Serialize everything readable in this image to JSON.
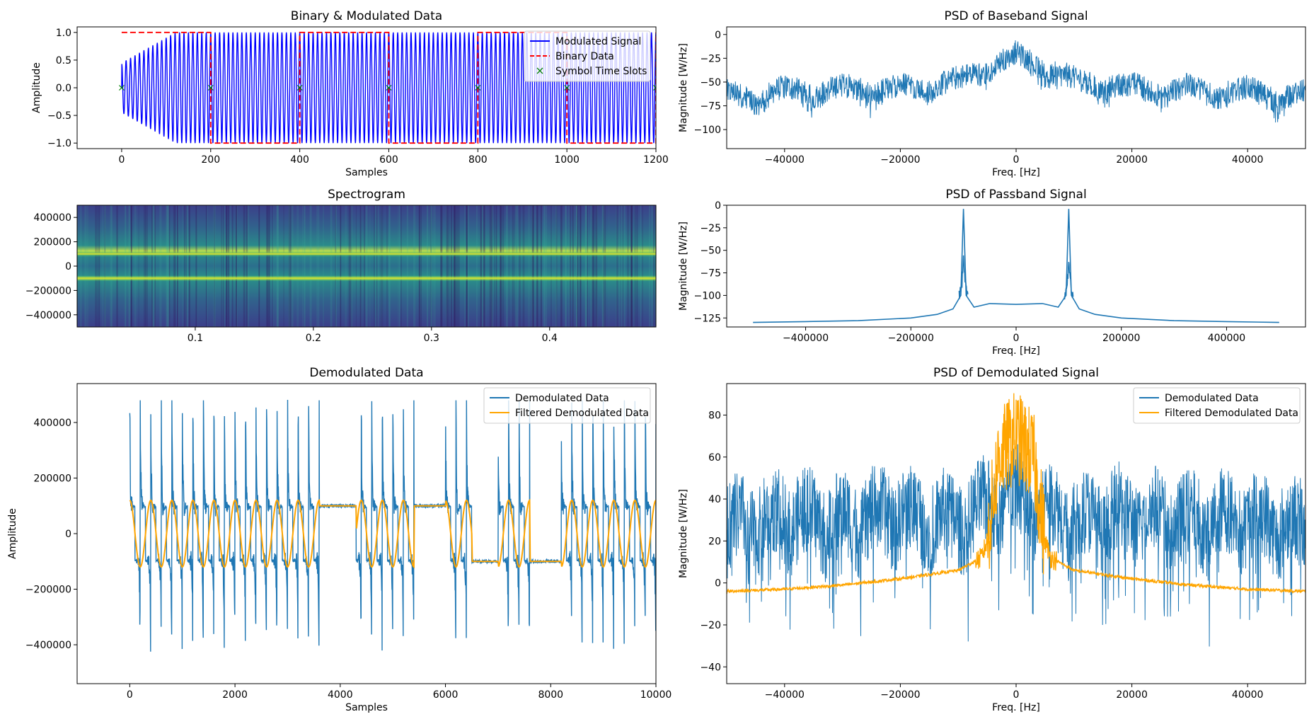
{
  "chart_data": [
    {
      "id": "binary-modulated",
      "type": "line",
      "title": "Binary & Modulated Data",
      "xlabel": "Samples",
      "ylabel": "Amplitude",
      "xlim": [
        -100,
        1200
      ],
      "ylim": [
        -1.1,
        1.1
      ],
      "xticks": [
        0,
        200,
        400,
        600,
        800,
        1000,
        1200
      ],
      "yticks": [
        -1.0,
        -0.5,
        0.0,
        0.5,
        1.0
      ],
      "xtick_labels": [
        "0",
        "200",
        "400",
        "600",
        "800",
        "1000",
        "1200"
      ],
      "ytick_labels": [
        "−1.0",
        "−0.5",
        "0.0",
        "0.5",
        "1.0"
      ],
      "legend_position": "top-right",
      "series": [
        {
          "name": "Modulated Signal",
          "color": "#0000ff",
          "style": "solid",
          "cycle_samples": 10
        },
        {
          "name": "Binary Data",
          "color": "#ff0000",
          "style": "dashed",
          "x": [
            0,
            200,
            200,
            400,
            400,
            600,
            600,
            800,
            800,
            1000,
            1000,
            1200,
            1200
          ],
          "y": [
            1,
            1,
            -1,
            -1,
            1,
            1,
            -1,
            -1,
            1,
            1,
            -1,
            -1,
            1
          ]
        },
        {
          "name": "Symbol Time Slots",
          "color": "#008000",
          "style": "marker-x",
          "x": [
            0,
            200,
            400,
            600,
            800,
            1000,
            1200
          ],
          "y": [
            0,
            0,
            0,
            0,
            0,
            0,
            0
          ]
        }
      ]
    },
    {
      "id": "psd-baseband",
      "type": "line",
      "title": "PSD of Baseband Signal",
      "xlabel": "Freq. [Hz]",
      "ylabel": "Magnitude [W/Hz]",
      "xlim": [
        -50000,
        50000
      ],
      "ylim": [
        -120,
        8
      ],
      "xticks": [
        -40000,
        -20000,
        0,
        20000,
        40000
      ],
      "yticks": [
        -100,
        -75,
        -50,
        -25,
        0
      ],
      "xtick_labels": [
        "−40000",
        "−20000",
        "0",
        "20000",
        "40000"
      ],
      "ytick_labels": [
        "−100",
        "−75",
        "−50",
        "−25",
        "0"
      ],
      "series": [
        {
          "name": "PSD",
          "color": "#1f77b4",
          "x": [
            -50000,
            -45000,
            -40000,
            -35000,
            -30000,
            -25000,
            -20000,
            -15000,
            -10000,
            -5000,
            0,
            5000,
            10000,
            15000,
            20000,
            25000,
            30000,
            35000,
            40000,
            45000,
            50000
          ],
          "y": [
            -60,
            -62,
            -55,
            -57,
            -53,
            -55,
            -52,
            -50,
            -45,
            -32,
            -18,
            -32,
            -45,
            -50,
            -52,
            -55,
            -53,
            -57,
            -55,
            -62,
            -60
          ]
        }
      ]
    },
    {
      "id": "spectrogram",
      "type": "heatmap",
      "title": "Spectrogram",
      "xlabel": "",
      "ylabel": "",
      "xlim": [
        0.0,
        0.49
      ],
      "ylim": [
        -500000,
        500000
      ],
      "xticks": [
        0.1,
        0.2,
        0.3,
        0.4
      ],
      "yticks": [
        -400000,
        -200000,
        0,
        200000,
        400000
      ],
      "xtick_labels": [
        "0.1",
        "0.2",
        "0.3",
        "0.4"
      ],
      "ytick_labels": [
        "−400000",
        "−200000",
        "0",
        "200000",
        "400000"
      ],
      "bright_lines_hz": [
        100000,
        -100000
      ],
      "colormap": [
        "#440154",
        "#3b528b",
        "#21918c",
        "#5ec962",
        "#fde725"
      ]
    },
    {
      "id": "psd-passband",
      "type": "line",
      "title": "PSD of Passband Signal",
      "xlabel": "Freq. [Hz]",
      "ylabel": "Magnitude [W/Hz]",
      "xlim": [
        -550000,
        550000
      ],
      "ylim": [
        -135,
        0
      ],
      "xticks": [
        -400000,
        -200000,
        0,
        200000,
        400000
      ],
      "yticks": [
        -125,
        -100,
        -75,
        -50,
        -25,
        0
      ],
      "xtick_labels": [
        "−400000",
        "−200000",
        "0",
        "200000",
        "400000"
      ],
      "ytick_labels": [
        "−125",
        "−100",
        "−75",
        "−50",
        "−25",
        "0"
      ],
      "series": [
        {
          "name": "PSD",
          "color": "#1f77b4",
          "x": [
            -500000,
            -400000,
            -300000,
            -200000,
            -150000,
            -120000,
            -105000,
            -100000,
            -95000,
            -80000,
            -50000,
            0,
            50000,
            80000,
            95000,
            100000,
            105000,
            120000,
            150000,
            200000,
            300000,
            400000,
            500000
          ],
          "y": [
            -130,
            -129,
            -128,
            -125,
            -121,
            -115,
            -100,
            -4,
            -100,
            -113,
            -109,
            -110,
            -109,
            -113,
            -100,
            -4,
            -100,
            -115,
            -121,
            -125,
            -128,
            -129,
            -130
          ]
        }
      ]
    },
    {
      "id": "demodulated",
      "type": "line",
      "title": "Demodulated Data",
      "xlabel": "Samples",
      "ylabel": "Amplitude",
      "xlim": [
        -1000,
        10000
      ],
      "ylim": [
        -540000,
        540000
      ],
      "xticks": [
        0,
        2000,
        4000,
        6000,
        8000,
        10000
      ],
      "yticks": [
        -400000,
        -200000,
        0,
        200000,
        400000
      ],
      "xtick_labels": [
        "0",
        "2000",
        "4000",
        "6000",
        "8000",
        "10000"
      ],
      "ytick_labels": [
        "−400000",
        "−200000",
        "0",
        "200000",
        "400000"
      ],
      "legend_position": "top-right",
      "segments": [
        {
          "x0": 0,
          "x1": 3600,
          "kind": "toggle"
        },
        {
          "x0": 3600,
          "x1": 4300,
          "kind": "high"
        },
        {
          "x0": 4300,
          "x1": 5400,
          "kind": "toggle"
        },
        {
          "x0": 5400,
          "x1": 6000,
          "kind": "high"
        },
        {
          "x0": 6000,
          "x1": 6500,
          "kind": "toggle"
        },
        {
          "x0": 6500,
          "x1": 7000,
          "kind": "low"
        },
        {
          "x0": 7000,
          "x1": 7600,
          "kind": "toggle"
        },
        {
          "x0": 7600,
          "x1": 8200,
          "kind": "low"
        },
        {
          "x0": 8200,
          "x1": 10000,
          "kind": "toggle"
        }
      ],
      "series": [
        {
          "name": "Demodulated Data",
          "color": "#1f77b4"
        },
        {
          "name": "Filtered Demodulated Data",
          "color": "#ffa500"
        }
      ]
    },
    {
      "id": "psd-demodulated",
      "type": "line",
      "title": "PSD of Demodulated Signal",
      "xlabel": "Freq. [Hz]",
      "ylabel": "Magnitude [W/Hz]",
      "xlim": [
        -50000,
        50000
      ],
      "ylim": [
        -48,
        95
      ],
      "xticks": [
        -40000,
        -20000,
        0,
        20000,
        40000
      ],
      "yticks": [
        -40,
        -20,
        0,
        20,
        40,
        60,
        80
      ],
      "xtick_labels": [
        "−40000",
        "−20000",
        "0",
        "20000",
        "40000"
      ],
      "ytick_labels": [
        "−40",
        "−20",
        "0",
        "20",
        "40",
        "60",
        "80"
      ],
      "legend_position": "top-right",
      "series": [
        {
          "name": "Demodulated Data",
          "color": "#1f77b4",
          "x": [
            -50000,
            -40000,
            -30000,
            -20000,
            -10000,
            -5000,
            0,
            5000,
            10000,
            20000,
            30000,
            40000,
            50000
          ],
          "y": [
            25,
            30,
            28,
            32,
            28,
            35,
            40,
            35,
            28,
            32,
            28,
            30,
            25
          ]
        },
        {
          "name": "Filtered Demodulated Data",
          "color": "#ffa500",
          "x": [
            -50000,
            -40000,
            -30000,
            -20000,
            -10000,
            -6000,
            -5000,
            -3000,
            0,
            3000,
            5000,
            6000,
            10000,
            20000,
            30000,
            40000,
            50000
          ],
          "y": [
            -4,
            -3,
            -1,
            2,
            6,
            12,
            20,
            60,
            70,
            60,
            20,
            12,
            6,
            2,
            -1,
            -3,
            -4
          ]
        }
      ]
    }
  ]
}
